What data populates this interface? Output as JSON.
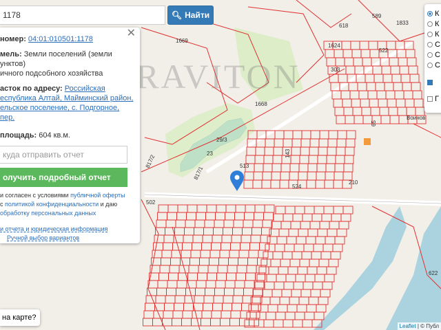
{
  "search": {
    "value": "1178",
    "button_label": "Найти"
  },
  "panel": {
    "number_label": "номер:",
    "number_value": "04:01:010501:1178",
    "land_label": "мель:",
    "land_value": "Земли поселений (земли",
    "land_value2": "унктов)",
    "purpose": "ичного подсобного хозяйства",
    "address_label": "асток по адресу:",
    "address_line1": "Российская",
    "address_line2": "еспублика Алтай, Майминский район,",
    "address_line3": "ельское поселение, с. Подгорное, пер.",
    "area_label": "площадь:",
    "area_value": "604 кв.м.",
    "email_placeholder": "куда отправить отчет",
    "report_button": "олучить подробный отчет",
    "agree_1": "и согласен с условиями",
    "agree_offer": "публичной оферты",
    "agree_2": "с",
    "agree_policy": "политикой конфиденциальности",
    "agree_3": "и даю",
    "agree_4": "обработку персональных данных",
    "info_link": "и отчета и юридическая информация",
    "manual_link": "Ручной выбор вариантов"
  },
  "map_question": "на карте?",
  "layers": {
    "options": [
      {
        "label": "К",
        "selected": true
      },
      {
        "label": "К",
        "selected": false
      },
      {
        "label": "К",
        "selected": false
      },
      {
        "label": "С",
        "selected": false
      },
      {
        "label": "С",
        "selected": false
      },
      {
        "label": "С",
        "selected": false
      }
    ],
    "checks": [
      {
        "label": "",
        "checked": true
      },
      {
        "label": "Г",
        "checked": false
      }
    ]
  },
  "watermark": "GRAVITON",
  "map_labels": {
    "l1669": "1669",
    "l1668": "1668",
    "l589": "589",
    "l1833": "1833",
    "l618": "618",
    "l1624": "1624",
    "l522": "522",
    "l303": "303",
    "l29": "29/3",
    "l23": "23",
    "l817": "817/2",
    "l8171": "817/1",
    "l513": "513",
    "l524": "524",
    "l210": "210",
    "l143": "143",
    "l502": "502",
    "l65": "65",
    "l622": "622",
    "war": "Воинов"
  },
  "attribution": {
    "leaflet": "Leaflet",
    "rest": "| © Публ"
  }
}
